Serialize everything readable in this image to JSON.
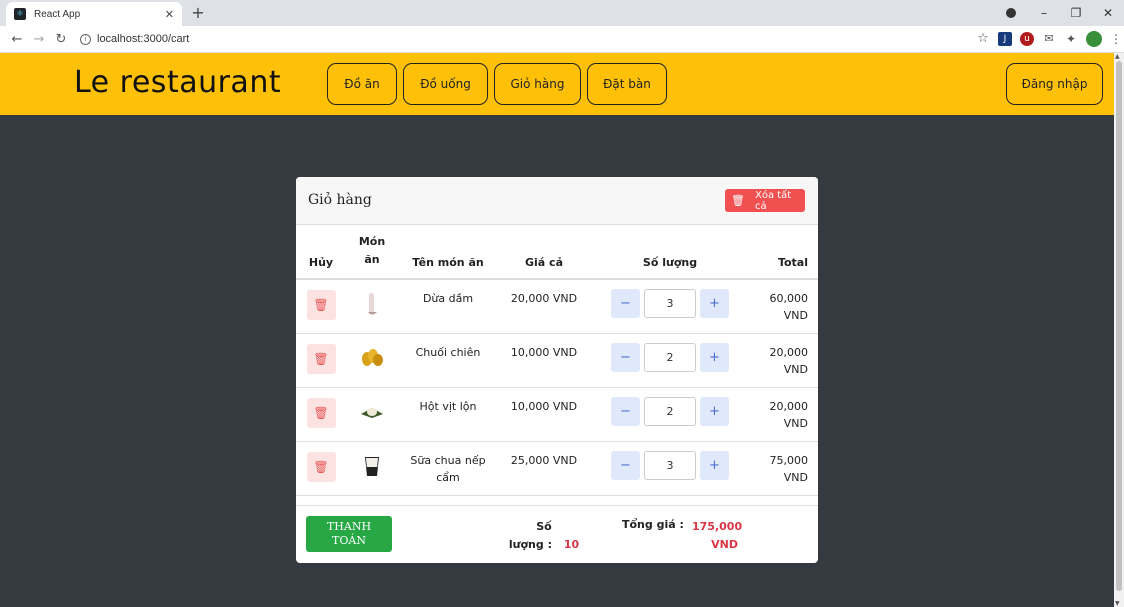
{
  "browser": {
    "tab_title": "React App",
    "url": "localhost:3000/cart"
  },
  "header": {
    "brand": "Le restaurant",
    "nav": [
      {
        "label": "Đồ ăn"
      },
      {
        "label": "Đồ uống"
      },
      {
        "label": "Giỏ hàng"
      },
      {
        "label": "Đặt bàn"
      }
    ],
    "login_label": "Đăng nhập",
    "color": "#ffc107"
  },
  "cart": {
    "title": "Giỏ hàng",
    "clear_all_label": "Xóa tất cả",
    "columns": {
      "cancel": "Hủy",
      "dish": "Món ăn",
      "name": "Tên món ăn",
      "price": "Giá cả",
      "quantity": "Số lượng",
      "total": "Total"
    },
    "items": [
      {
        "name": "Dừa dầm",
        "price": "20,000 VND",
        "qty": "3",
        "total_num": "60,000",
        "total_unit": "VND",
        "icon": "coconut-drink-icon"
      },
      {
        "name": "Chuối chiên",
        "price": "10,000 VND",
        "qty": "2",
        "total_num": "20,000",
        "total_unit": "VND",
        "icon": "fried-banana-icon"
      },
      {
        "name": "Hột vịt lộn",
        "price": "10,000 VND",
        "qty": "2",
        "total_num": "20,000",
        "total_unit": "VND",
        "icon": "balut-egg-icon"
      },
      {
        "name": "Sữa chua nếp cẩm",
        "price": "25,000 VND",
        "qty": "3",
        "total_num": "75,000",
        "total_unit": "VND",
        "icon": "yogurt-icon"
      }
    ],
    "footer": {
      "pay_label_1": "THANH",
      "pay_label_2": "TOÁN",
      "count_label_1": "Số",
      "count_label_2": "lượng :",
      "count_value": "10",
      "total_label": "Tổng giá :",
      "total_value_1": "175,000",
      "total_value_2": "VND"
    }
  }
}
